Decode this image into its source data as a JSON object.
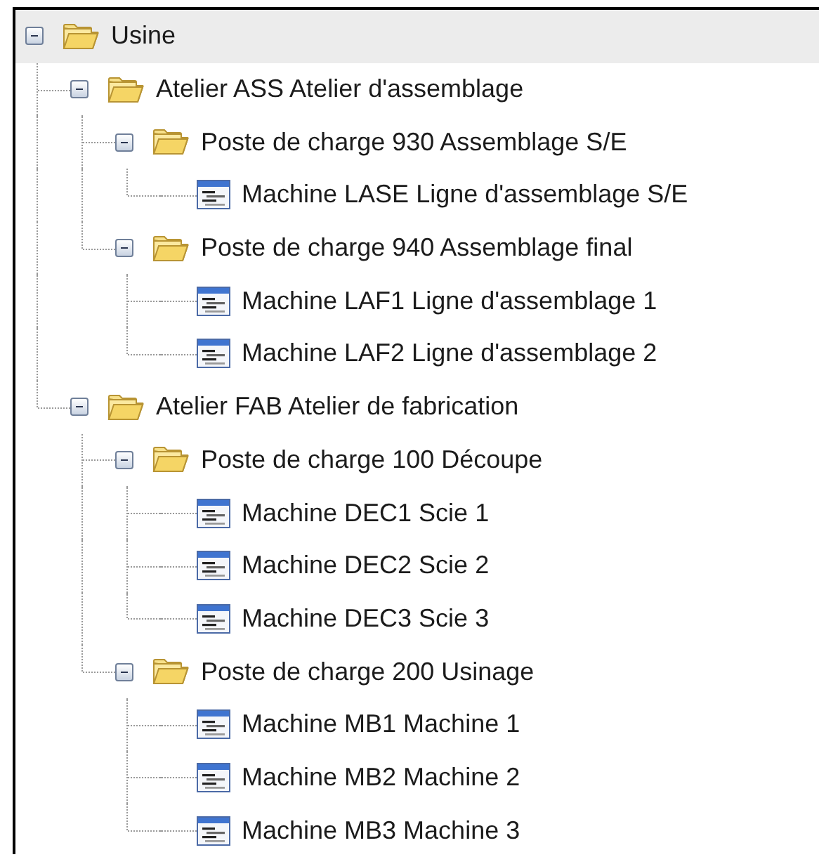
{
  "tree": [
    {
      "label": "Usine",
      "kind": "folder",
      "expanded": true,
      "selected": true,
      "children": [
        {
          "label": "Atelier ASS Atelier d'assemblage",
          "kind": "folder",
          "expanded": true,
          "selected": false,
          "children": [
            {
              "label": "Poste de charge 930 Assemblage S/E",
              "kind": "folder",
              "expanded": true,
              "selected": false,
              "children": [
                {
                  "label": "Machine LASE Ligne d'assemblage S/E",
                  "kind": "machine",
                  "selected": false
                }
              ]
            },
            {
              "label": "Poste de charge 940 Assemblage final",
              "kind": "folder",
              "expanded": true,
              "selected": false,
              "children": [
                {
                  "label": "Machine LAF1 Ligne d'assemblage 1",
                  "kind": "machine",
                  "selected": false
                },
                {
                  "label": "Machine LAF2 Ligne d'assemblage 2",
                  "kind": "machine",
                  "selected": false
                }
              ]
            }
          ]
        },
        {
          "label": "Atelier FAB Atelier de fabrication",
          "kind": "folder",
          "expanded": true,
          "selected": false,
          "children": [
            {
              "label": "Poste de charge 100 Découpe",
              "kind": "folder",
              "expanded": true,
              "selected": false,
              "children": [
                {
                  "label": "Machine DEC1 Scie 1",
                  "kind": "machine",
                  "selected": false
                },
                {
                  "label": "Machine DEC2 Scie 2",
                  "kind": "machine",
                  "selected": false
                },
                {
                  "label": "Machine DEC3 Scie 3",
                  "kind": "machine",
                  "selected": false
                }
              ]
            },
            {
              "label": "Poste de charge 200 Usinage",
              "kind": "folder",
              "expanded": true,
              "selected": false,
              "children": [
                {
                  "label": "Machine MB1 Machine 1",
                  "kind": "machine",
                  "selected": false
                },
                {
                  "label": "Machine MB2 Machine 2",
                  "kind": "machine",
                  "selected": false
                },
                {
                  "label": "Machine MB3 Machine 3",
                  "kind": "machine",
                  "selected": false
                }
              ]
            }
          ]
        }
      ]
    }
  ]
}
